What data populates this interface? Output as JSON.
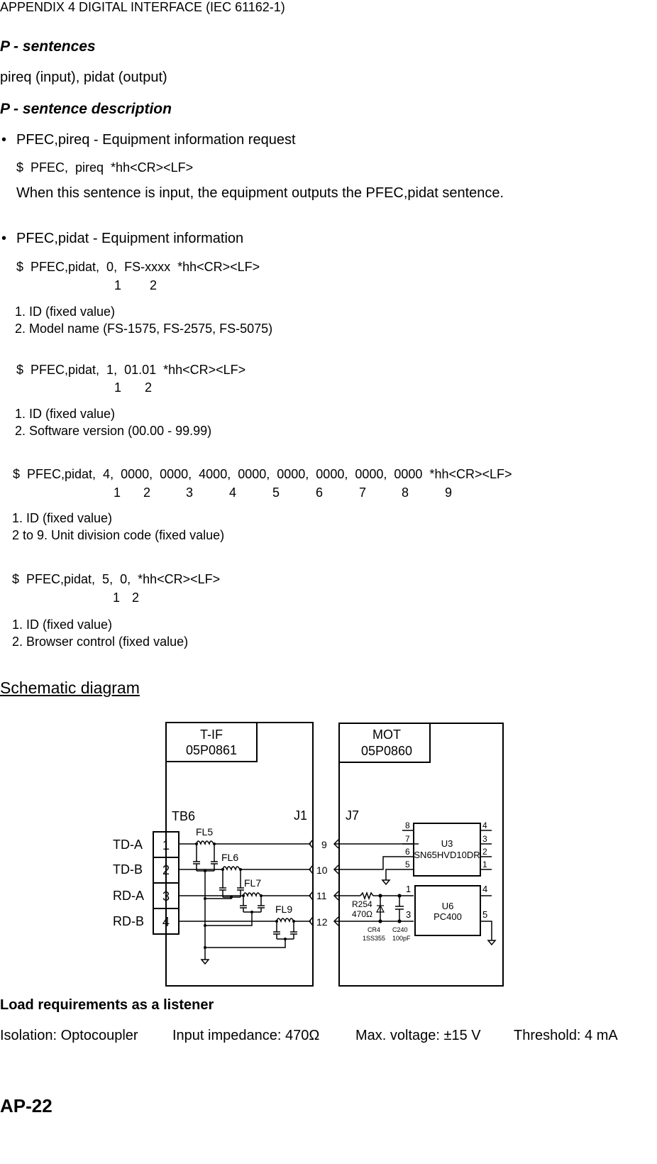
{
  "header": {
    "title": "APPENDIX 4 DIGITAL INTERFACE (IEC 61162-1)"
  },
  "p_sentences": {
    "heading": "P - sentences",
    "summary": "pireq (input), pidat (output)"
  },
  "p_desc": {
    "heading": "P - sentence description",
    "pireq": {
      "bullet": "•",
      "title": "PFEC,pireq - Equipment information request",
      "format": "$  PFEC,  pireq  *hh<CR><LF>",
      "note": "When this sentence is input, the equipment outputs the PFEC,pidat sentence."
    },
    "pidat": {
      "bullet": "•",
      "title": "PFEC,pidat - Equipment information",
      "blocks": [
        {
          "format": "$  PFEC,pidat,  0,  FS-xxxx  *hh<CR><LF>",
          "fields": [
            "1",
            "2"
          ],
          "notes": [
            "1. ID (fixed value)",
            "2. Model name (FS-1575, FS-2575, FS-5075)"
          ]
        },
        {
          "format": "$  PFEC,pidat,  1,  01.01  *hh<CR><LF>",
          "fields": [
            "1",
            "2"
          ],
          "notes": [
            "1. ID (fixed value)",
            "2. Software version (00.00 - 99.99)"
          ]
        },
        {
          "format": "$  PFEC,pidat,  4,  0000,  0000,  4000,  0000,  0000,  0000,  0000,  0000  *hh<CR><LF>",
          "fields": [
            "1",
            "2",
            "3",
            "4",
            "5",
            "6",
            "7",
            "8",
            "9"
          ],
          "notes": [
            "1. ID (fixed value)",
            "2 to 9. Unit division code (fixed value)"
          ]
        },
        {
          "format": "$  PFEC,pidat,  5,  0,  *hh<CR><LF>",
          "fields": [
            "1",
            "2"
          ],
          "notes": [
            "1. ID (fixed value)",
            "2. Browser control (fixed value)"
          ]
        }
      ]
    }
  },
  "schematic": {
    "title": "Schematic diagram",
    "left_board": {
      "name": "T-IF",
      "part": "05P0861",
      "terminal": "TB6",
      "connector": "J1"
    },
    "right_board": {
      "name": "MOT",
      "part": "05P0860",
      "connector": "J7"
    },
    "signals": [
      "TD-A",
      "TD-B",
      "RD-A",
      "RD-B"
    ],
    "tb_pins": [
      "1",
      "2",
      "3",
      "4"
    ],
    "filters": [
      "FL5",
      "FL6",
      "FL7",
      "FL9"
    ],
    "connector_pins": [
      "9",
      "10",
      "11",
      "12"
    ],
    "u3": {
      "ref": "U3",
      "part": "SN65HVD10DR",
      "left_pins": [
        "8",
        "7",
        "6",
        "5"
      ],
      "right_pins": [
        "4",
        "3",
        "2",
        "1"
      ]
    },
    "u6": {
      "ref": "U6",
      "part": "PC400",
      "left_pins": [
        "1",
        "3"
      ],
      "right_pins": [
        "4",
        "5"
      ]
    },
    "r254": {
      "ref": "R254",
      "value": "470Ω"
    },
    "cr4": {
      "ref": "CR4",
      "part": "1SS355"
    },
    "c240": {
      "ref": "C240",
      "value": "100pF"
    }
  },
  "load": {
    "heading": "Load requirements as a listener",
    "isolation": "Isolation: Optocoupler",
    "impedance": "Input impedance: 470Ω",
    "voltage": "Max. voltage: ±15 V",
    "threshold": "Threshold: 4 mA"
  },
  "footer": {
    "page": "AP-22"
  }
}
